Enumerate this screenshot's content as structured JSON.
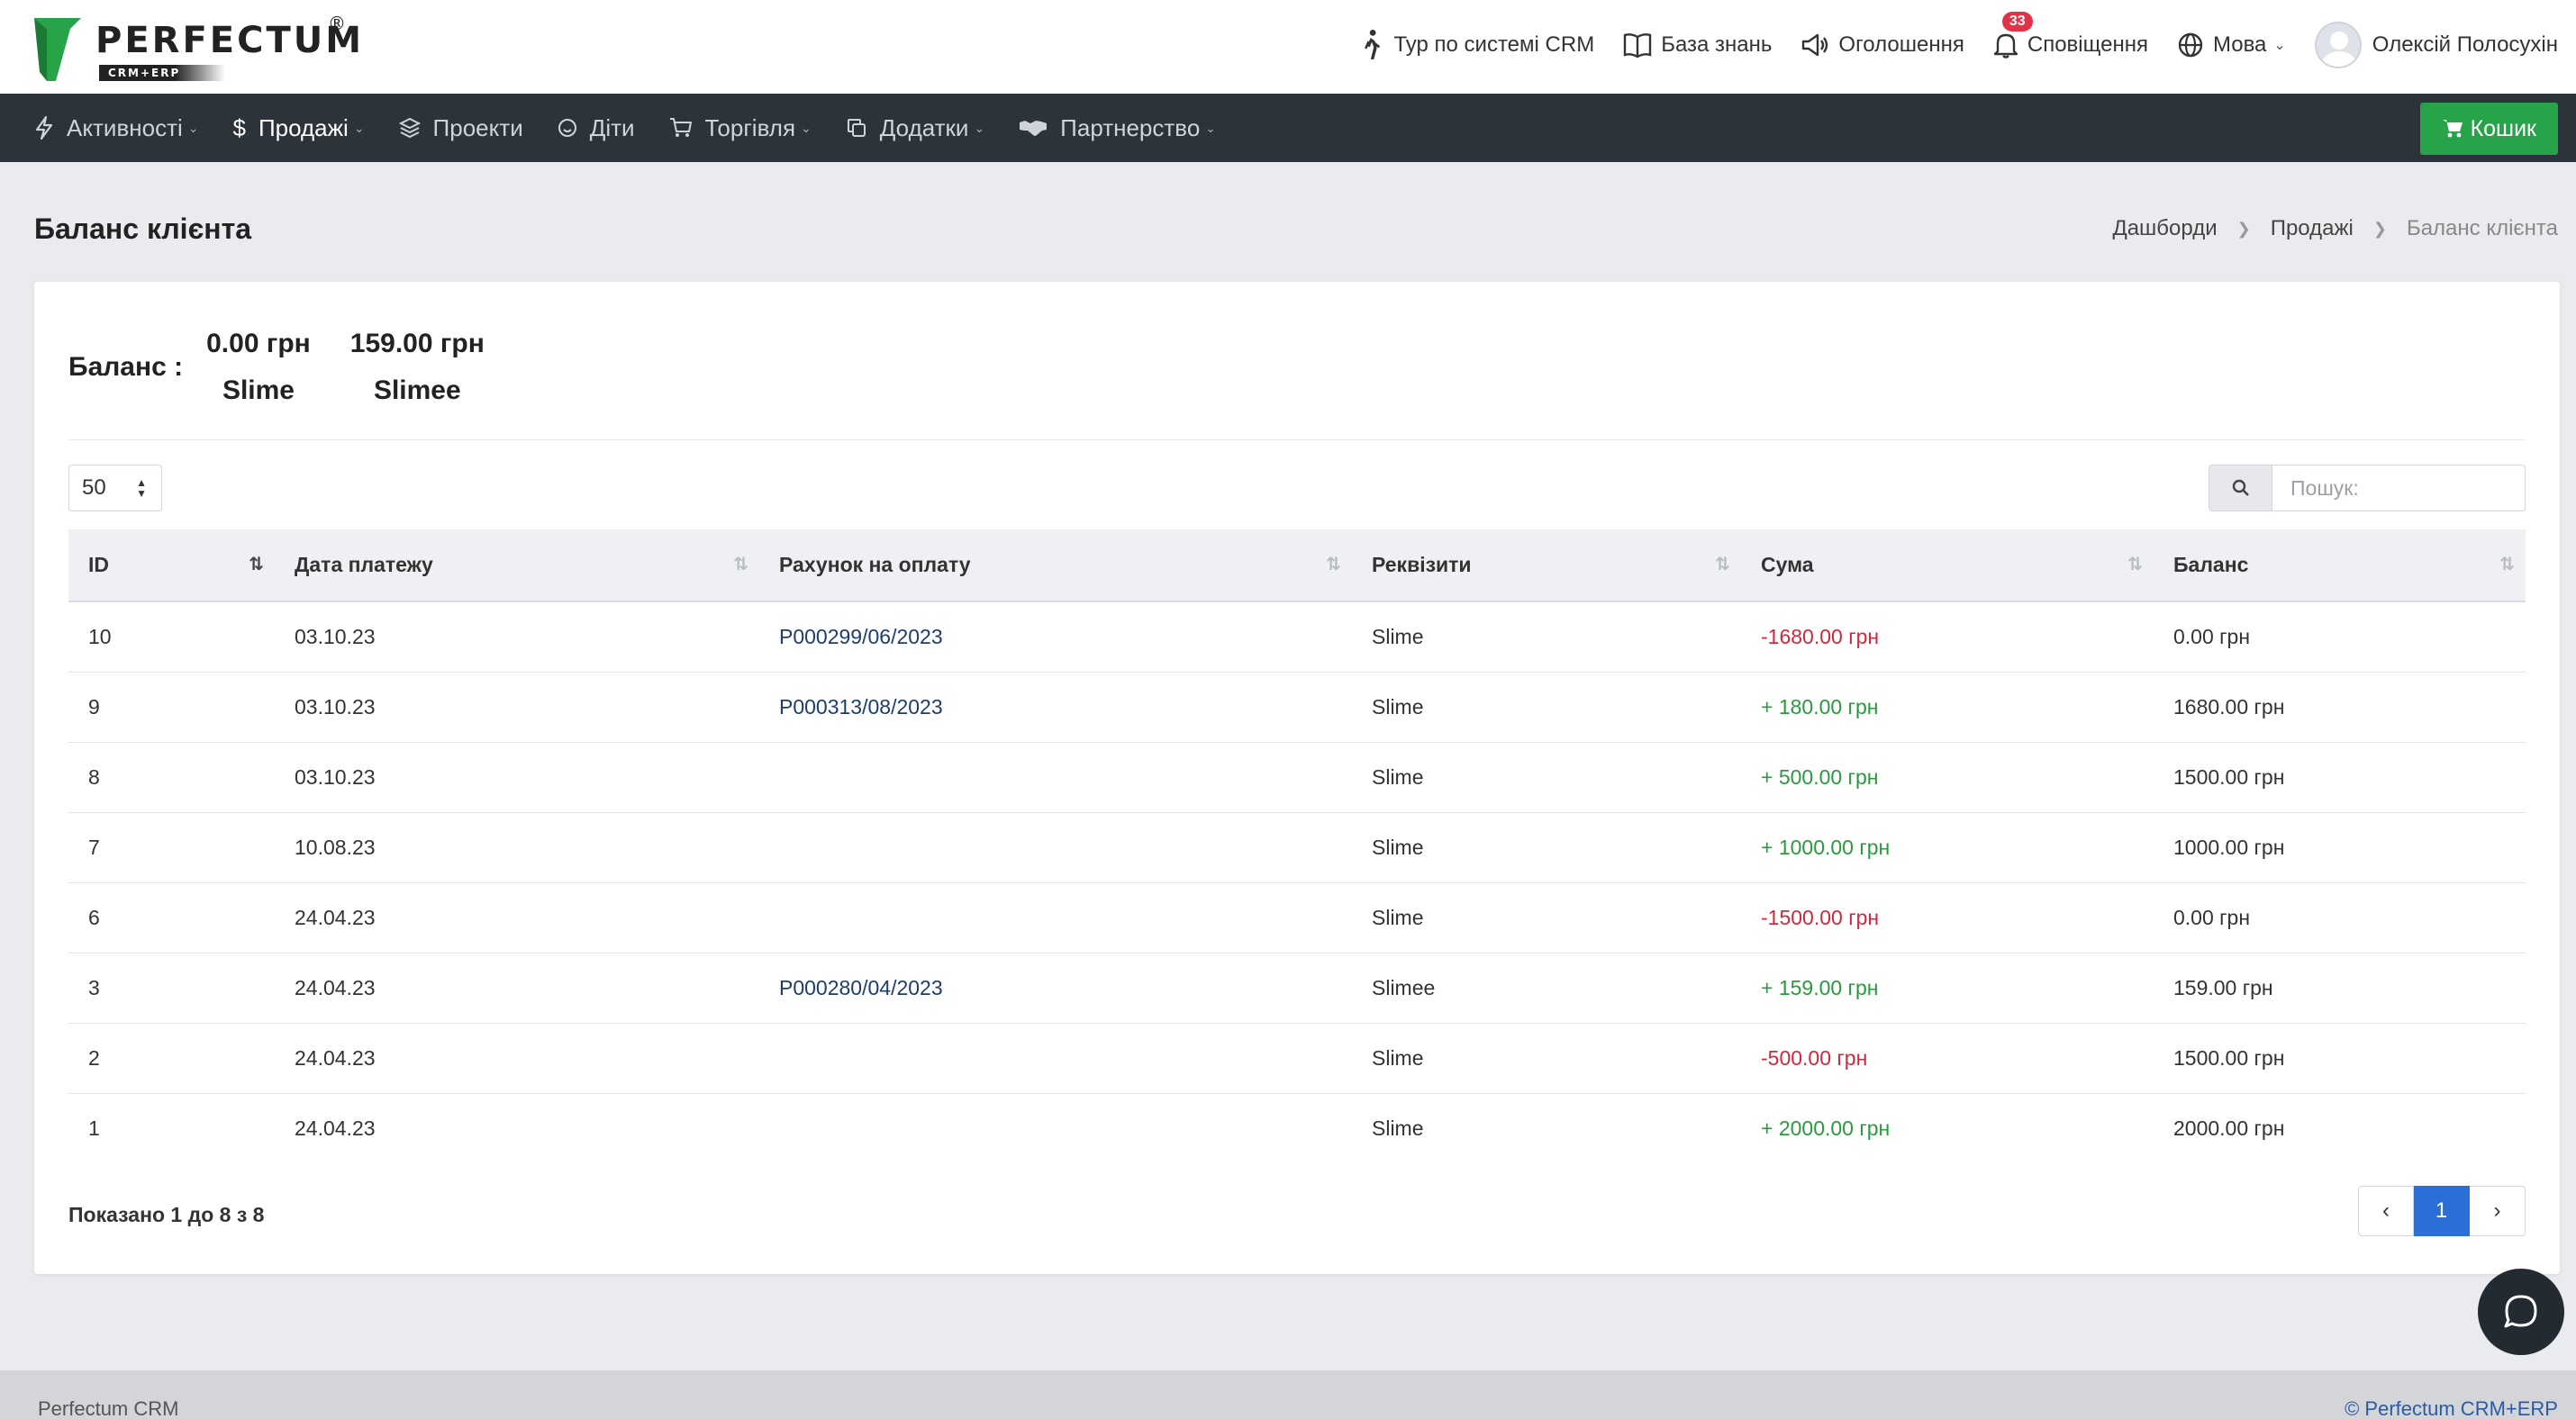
{
  "brand": {
    "name": "PERFECTUM",
    "sub": "CRM+ERP",
    "reg": "®",
    "green": "#27a34a"
  },
  "topnav": {
    "tour": "Тур по системі CRM",
    "knowledge": "База знань",
    "announcements": "Оголошення",
    "notifications": "Сповіщення",
    "notifications_count": "33",
    "language": "Мова",
    "user": "Олексій Полосухін"
  },
  "menu": {
    "items": [
      {
        "label": "Активності",
        "icon": "bolt-icon"
      },
      {
        "label": "Продажі",
        "icon": "dollar-icon"
      },
      {
        "label": "Проекти",
        "icon": "layers-icon"
      },
      {
        "label": "Діти",
        "icon": "smile-icon"
      },
      {
        "label": "Торгівля",
        "icon": "cart-icon"
      },
      {
        "label": "Додатки",
        "icon": "copy-icon"
      },
      {
        "label": "Партнерство",
        "icon": "handshake-icon"
      }
    ],
    "cart_button": "Кошик"
  },
  "page": {
    "title": "Баланс клієнта",
    "breadcrumb": [
      "Дашборди",
      "Продажі",
      "Баланс клієнта"
    ]
  },
  "balance": {
    "label": "Баланс :",
    "entries": [
      {
        "amount": "0.00 грн",
        "name": "Slime"
      },
      {
        "amount": "159.00 грн",
        "name": "Slimee"
      }
    ]
  },
  "controls": {
    "page_length": "50",
    "search_placeholder": "Пошук:"
  },
  "table": {
    "columns": [
      "ID",
      "Дата платежу",
      "Рахунок на оплату",
      "Реквізити",
      "Сума",
      "Баланс"
    ],
    "rows": [
      {
        "id": "10",
        "date": "03.10.23",
        "invoice": "P000299/06/2023",
        "details": "Slime",
        "sum": "-1680.00 грн",
        "sign": "neg",
        "balance": "0.00 грн"
      },
      {
        "id": "9",
        "date": "03.10.23",
        "invoice": "P000313/08/2023",
        "details": "Slime",
        "sum": "+ 180.00 грн",
        "sign": "pos",
        "balance": "1680.00 грн"
      },
      {
        "id": "8",
        "date": "03.10.23",
        "invoice": "",
        "details": "Slime",
        "sum": "+ 500.00 грн",
        "sign": "pos",
        "balance": "1500.00 грн"
      },
      {
        "id": "7",
        "date": "10.08.23",
        "invoice": "",
        "details": "Slime",
        "sum": "+ 1000.00 грн",
        "sign": "pos",
        "balance": "1000.00 грн"
      },
      {
        "id": "6",
        "date": "24.04.23",
        "invoice": "",
        "details": "Slime",
        "sum": "-1500.00 грн",
        "sign": "neg",
        "balance": "0.00 грн"
      },
      {
        "id": "3",
        "date": "24.04.23",
        "invoice": "P000280/04/2023",
        "details": "Slimee",
        "sum": "+ 159.00 грн",
        "sign": "pos",
        "balance": "159.00 грн"
      },
      {
        "id": "2",
        "date": "24.04.23",
        "invoice": "",
        "details": "Slime",
        "sum": "-500.00 грн",
        "sign": "neg",
        "balance": "1500.00 грн"
      },
      {
        "id": "1",
        "date": "24.04.23",
        "invoice": "",
        "details": "Slime",
        "sum": "+ 2000.00 грн",
        "sign": "pos",
        "balance": "2000.00 грн"
      }
    ]
  },
  "pagination": {
    "info": "Показано 1 до 8 з 8",
    "current": "1",
    "prev": "‹",
    "next": "›"
  },
  "footer": {
    "left": "Perfectum CRM",
    "right": "© Perfectum CRM+ERP"
  }
}
